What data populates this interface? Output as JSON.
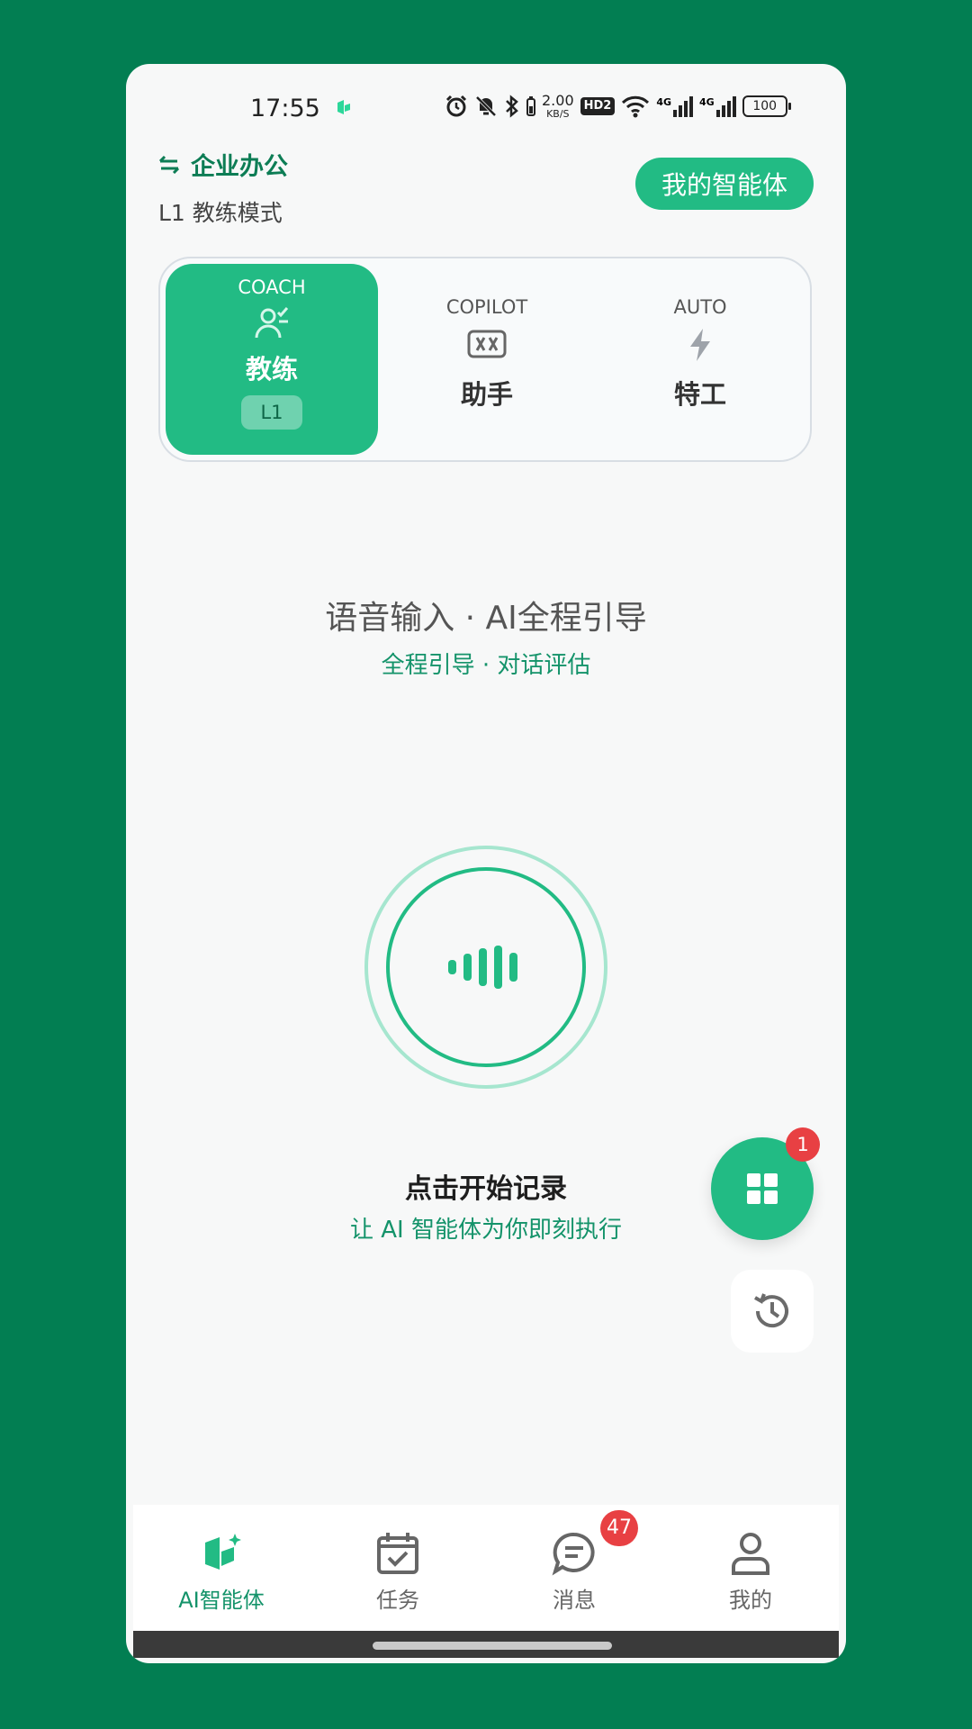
{
  "status_bar": {
    "time": "17:55",
    "speed_value": "2.00",
    "speed_unit": "KB/S",
    "hd_label": "HD2",
    "network_1": "4G",
    "network_2": "4G",
    "battery": "100"
  },
  "header": {
    "org_name": "企业办公",
    "mode_text": "L1 教练模式",
    "my_agent_button": "我的智能体"
  },
  "modes": [
    {
      "en": "COACH",
      "cn": "教练",
      "badge": "L1",
      "active": true,
      "icon": "coach-icon"
    },
    {
      "en": "COPILOT",
      "cn": "助手",
      "active": false,
      "icon": "copilot-icon"
    },
    {
      "en": "AUTO",
      "cn": "特工",
      "active": false,
      "icon": "bolt-icon"
    }
  ],
  "hero": {
    "title": "语音输入 · AI全程引导",
    "subtitle": "全程引导 · 对话评估"
  },
  "record": {
    "title": "点击开始记录",
    "subtitle": "让 AI 智能体为你即刻执行"
  },
  "floating": {
    "apps_badge": "1"
  },
  "tabbar": {
    "items": [
      {
        "label": "AI智能体",
        "icon": "agent-icon",
        "active": true
      },
      {
        "label": "任务",
        "icon": "calendar-check-icon",
        "active": false
      },
      {
        "label": "消息",
        "icon": "chat-icon",
        "active": false,
        "badge": "47"
      },
      {
        "label": "我的",
        "icon": "person-icon",
        "active": false
      }
    ]
  },
  "colors": {
    "background": "#027e52",
    "accent": "#22bb84",
    "accent_text": "#14936a",
    "badge": "#e84043"
  }
}
